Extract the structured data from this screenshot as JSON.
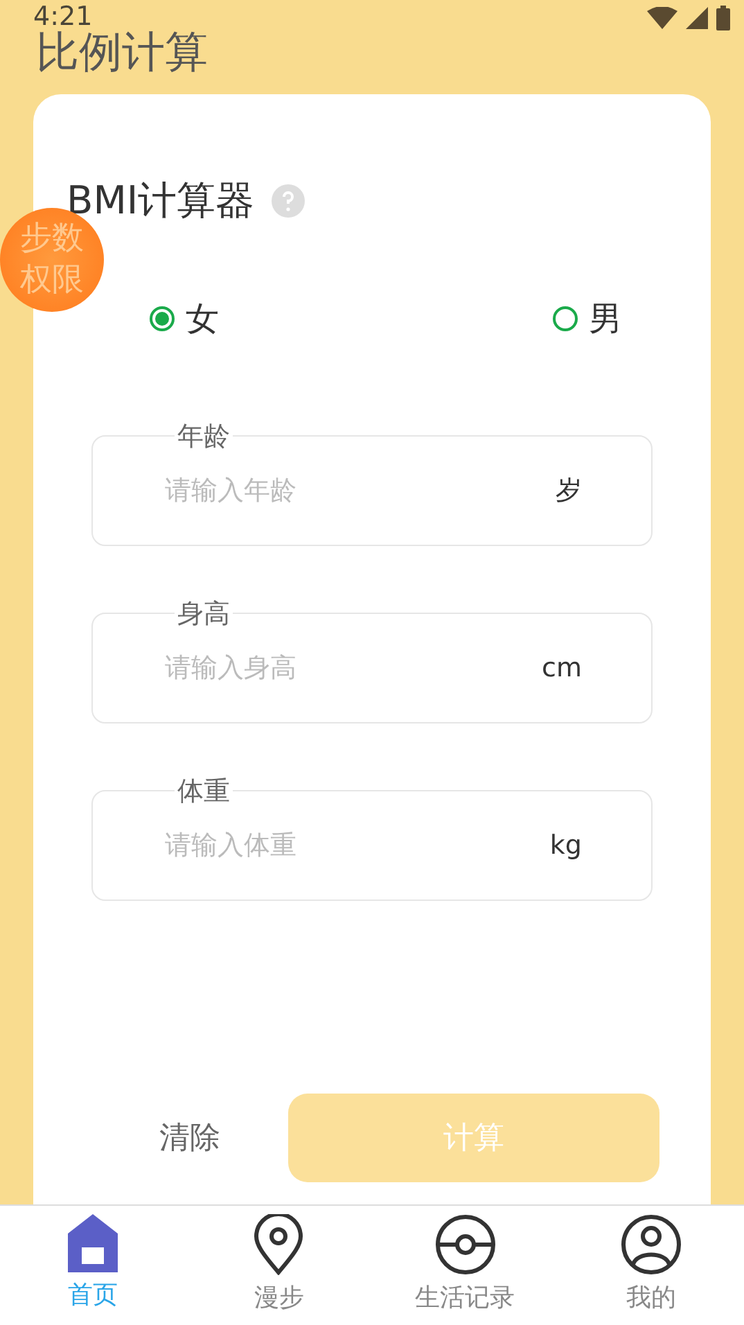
{
  "status_bar": {
    "time": "4:21"
  },
  "title": "比例计算",
  "floating_badge": {
    "label": "步数权限"
  },
  "card": {
    "title": "BMI计算器",
    "genders": [
      {
        "label": "女",
        "selected": true
      },
      {
        "label": "男",
        "selected": false
      }
    ],
    "fields": [
      {
        "label": "年龄",
        "placeholder": "请输入年龄",
        "unit": "岁"
      },
      {
        "label": "身高",
        "placeholder": "请输入身高",
        "unit": "cm"
      },
      {
        "label": "体重",
        "placeholder": "请输入体重",
        "unit": "kg"
      }
    ],
    "clear_button": "清除",
    "calculate_button": {
      "label": "计算",
      "disabled": true
    }
  },
  "nav": [
    {
      "label": "首页",
      "kind": "home",
      "selected": true
    },
    {
      "label": "漫步",
      "kind": "pin",
      "selected": false
    },
    {
      "label": "生活记录",
      "kind": "record",
      "selected": false
    },
    {
      "label": "我的",
      "kind": "user",
      "selected": false
    }
  ]
}
